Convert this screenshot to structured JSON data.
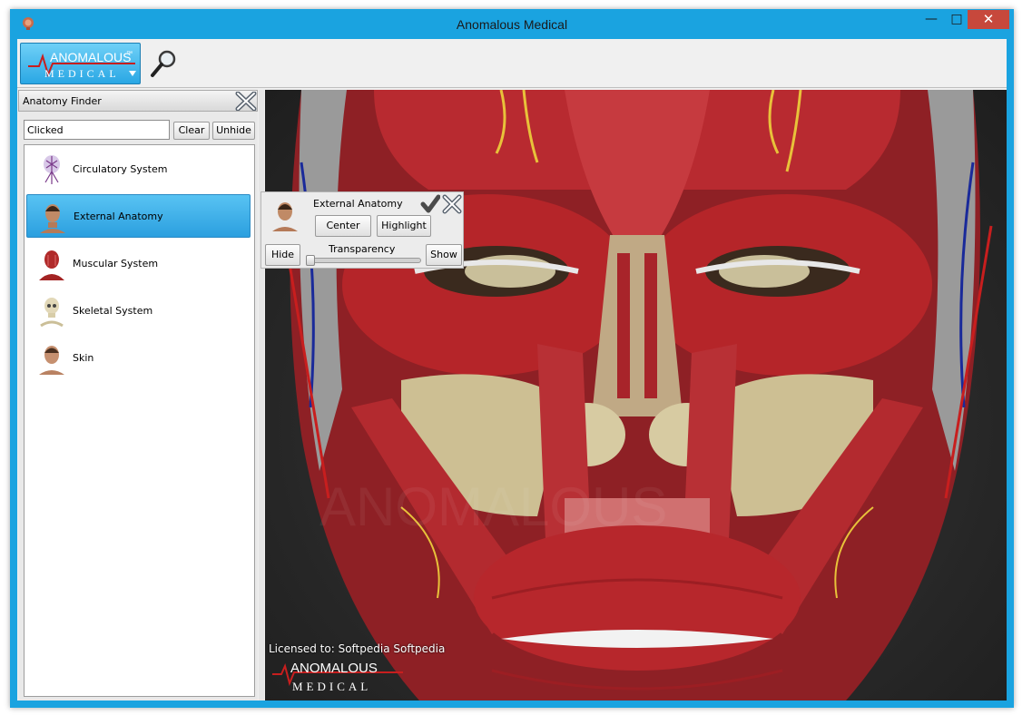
{
  "window": {
    "title": "Anomalous Medical",
    "minimize_glyph": "—",
    "maximize_glyph": "□",
    "close_glyph": "✕"
  },
  "toolbar": {
    "logo_top": "ANOMALOUS",
    "logo_bottom": "MEDICAL",
    "logo_trademark": "™",
    "search_icon": "magnifier-icon"
  },
  "finder": {
    "title": "Anatomy Finder",
    "search_value": "Clicked",
    "clear_label": "Clear",
    "unhide_label": "Unhide",
    "items": [
      {
        "label": "Circulatory System",
        "icon": "circulatory-icon",
        "selected": false
      },
      {
        "label": "External Anatomy",
        "icon": "external-anatomy-icon",
        "selected": true
      },
      {
        "label": "Muscular System",
        "icon": "muscular-icon",
        "selected": false
      },
      {
        "label": "Skeletal System",
        "icon": "skeletal-icon",
        "selected": false
      },
      {
        "label": "Skin",
        "icon": "skin-icon",
        "selected": false
      }
    ]
  },
  "popup": {
    "title": "External Anatomy",
    "center_label": "Center",
    "highlight_label": "Highlight",
    "hide_label": "Hide",
    "show_label": "Show",
    "transparency_label": "Transparency",
    "transparency_value": 0
  },
  "viewport": {
    "license_text": "Licensed to: Softpedia Softpedia",
    "logo_top": "ANOMALOUS",
    "logo_bottom": "MEDICAL"
  },
  "colors": {
    "frame": "#1aa3e0",
    "selected": "#3aaee6",
    "muscle": "#b3232a",
    "close_button": "#c7483c"
  }
}
